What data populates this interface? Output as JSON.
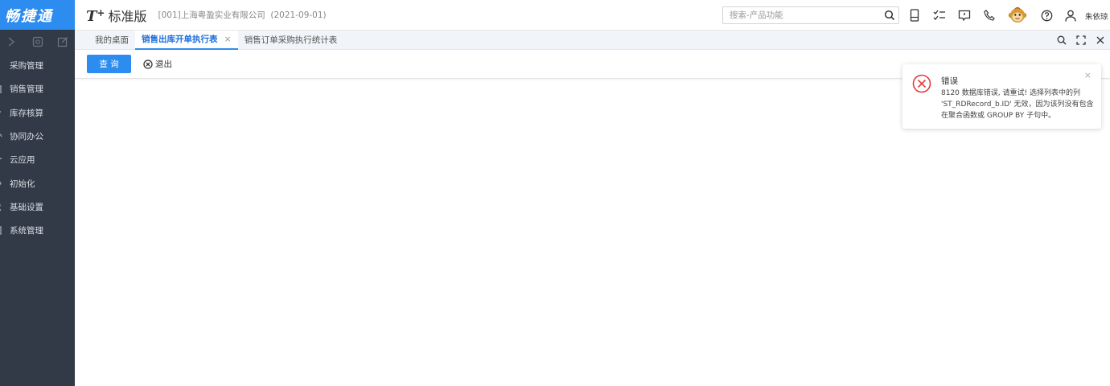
{
  "brand": "畅捷通",
  "header": {
    "logo_t": "T",
    "logo_plus": "+",
    "logo_text": "标准版",
    "company": "[001]上海粤盈实业有限公司",
    "date": "(2021-09-01)",
    "search_placeholder": "搜索-产品功能",
    "username": "朱依琼"
  },
  "sidebar": {
    "items": [
      {
        "label": "采购管理",
        "icon": "purchase-icon"
      },
      {
        "label": "销售管理",
        "icon": "sales-icon"
      },
      {
        "label": "库存核算",
        "icon": "inventory-icon"
      },
      {
        "label": "协同办公",
        "icon": "collab-icon"
      },
      {
        "label": "云应用",
        "icon": "cloud-icon"
      },
      {
        "label": "初始化",
        "icon": "init-icon"
      },
      {
        "label": "基础设置",
        "icon": "settings-icon"
      },
      {
        "label": "系统管理",
        "icon": "system-icon"
      }
    ]
  },
  "tabs": [
    {
      "label": "我的桌面",
      "active": false
    },
    {
      "label": "销售出库开单执行表",
      "active": true,
      "close": "×"
    },
    {
      "label": "销售订单采购执行统计表",
      "active": false
    }
  ],
  "toolbar": {
    "query_label": "查 询",
    "exit_label": "退出"
  },
  "toast": {
    "title": "错误",
    "message": "8120 数据库错误, 请重试! 选择列表中的列 'ST_RDRecord_b.ID' 无效，因为该列没有包含在聚合函数或 GROUP BY 子句中。",
    "close": "×"
  },
  "colors": {
    "accent": "#2d8cf0",
    "sidebar_bg": "#323a47",
    "error": "#e23b3b"
  }
}
